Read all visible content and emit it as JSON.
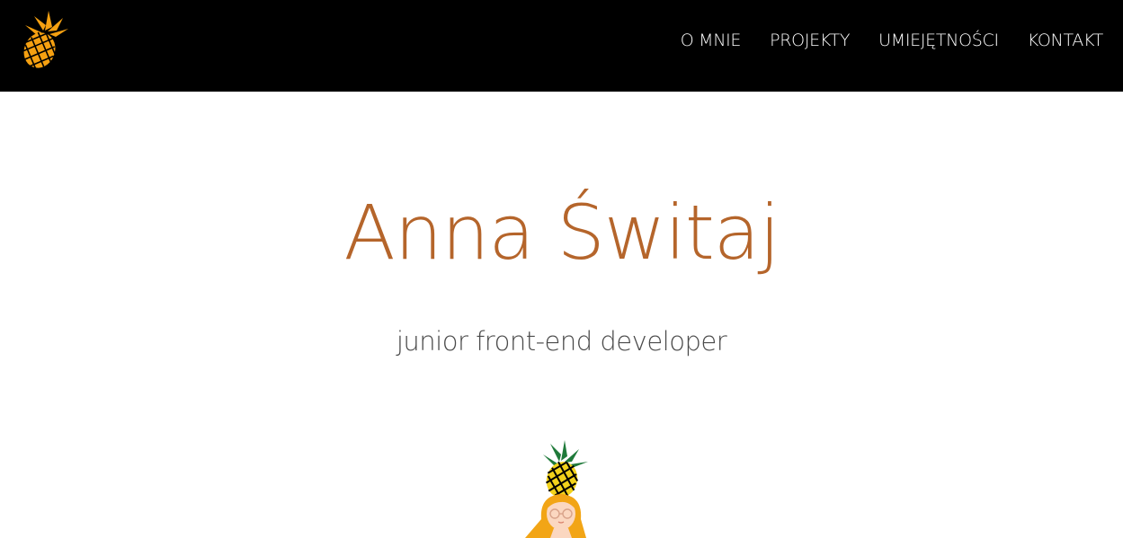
{
  "nav": {
    "logo_icon": "pineapple-icon",
    "items": [
      {
        "label": "O MNIE"
      },
      {
        "label": "PROJEKTY"
      },
      {
        "label": "UMIEJĘTNOŚCI"
      },
      {
        "label": "KONTAKT"
      }
    ]
  },
  "hero": {
    "name": "Anna Świtaj",
    "subtitle": "junior front-end developer",
    "illustration": "girl-with-pineapple-illustration"
  },
  "colors": {
    "navbar_bg": "#000000",
    "nav_text": "#ffffff",
    "accent": "#b5652b",
    "subtitle_text": "#4a4a4a",
    "logo_orange": "#f5a011"
  }
}
